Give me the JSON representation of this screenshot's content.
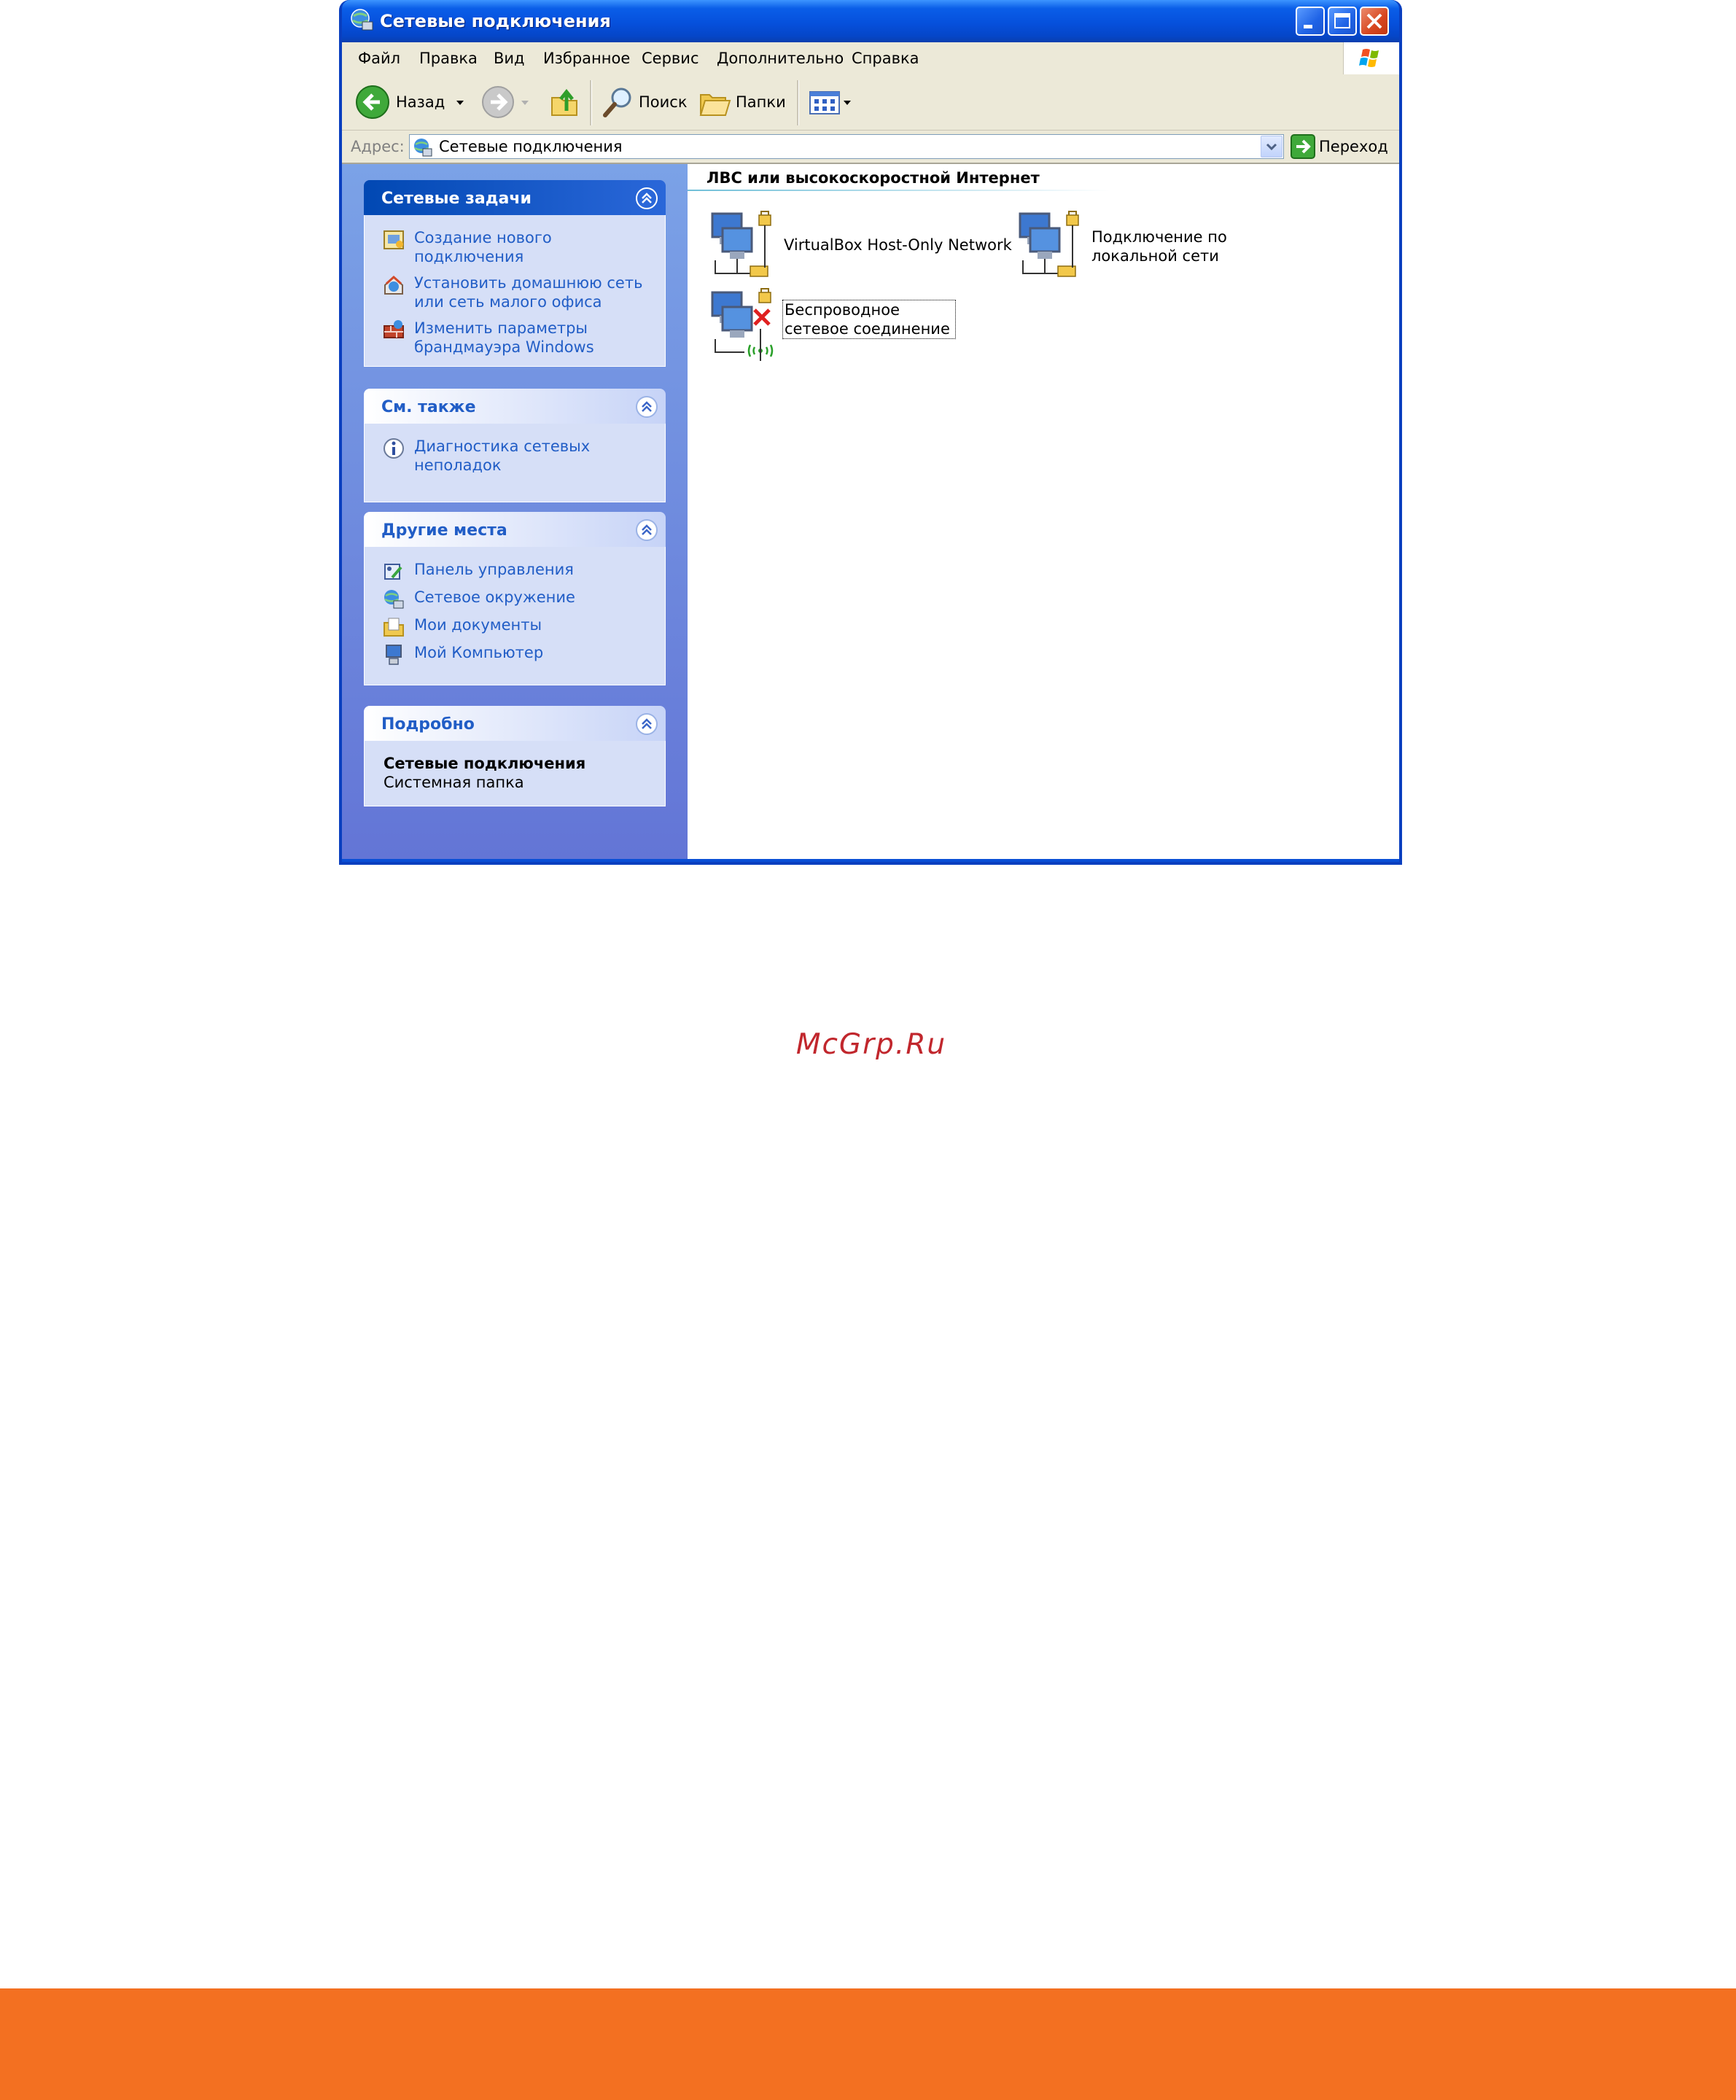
{
  "window": {
    "title": "Сетевые подключения",
    "title_color": "#0a5ee8"
  },
  "menu": [
    "Файл",
    "Правка",
    "Вид",
    "Избранное",
    "Сервис",
    "Дополнительно",
    "Справка"
  ],
  "toolbar": {
    "back_label": "Назад",
    "search_label": "Поиск",
    "folders_label": "Папки"
  },
  "address": {
    "label": "Адрес:",
    "value": "Сетевые подключения",
    "go_label": "Переход"
  },
  "taskpane": {
    "network_tasks": {
      "title": "Сетевые задачи",
      "items": [
        "Создание нового подключения",
        "Установить домашнюю сеть или сеть малого офиса",
        "Изменить параметры брандмауэра Windows"
      ]
    },
    "see_also": {
      "title": "См. также",
      "items": [
        "Диагностика сетевых неполадок"
      ]
    },
    "other_places": {
      "title": "Другие места",
      "items": [
        "Панель управления",
        "Сетевое окружение",
        "Мои документы",
        "Мой Компьютер"
      ]
    },
    "details": {
      "title": "Подробно",
      "name": "Сетевые подключения",
      "type": "Системная папка"
    }
  },
  "content": {
    "group_title": "ЛВС или высокоскоростной Интернет",
    "connections": [
      "VirtualBox Host-Only Network",
      "Подключение по локальной сети",
      "Беспроводное сетевое соединение"
    ]
  },
  "watermark": "McGrp.Ru",
  "colors": {
    "footer": "#f37021",
    "watermark": "#c1272d",
    "link": "#215dc6"
  }
}
